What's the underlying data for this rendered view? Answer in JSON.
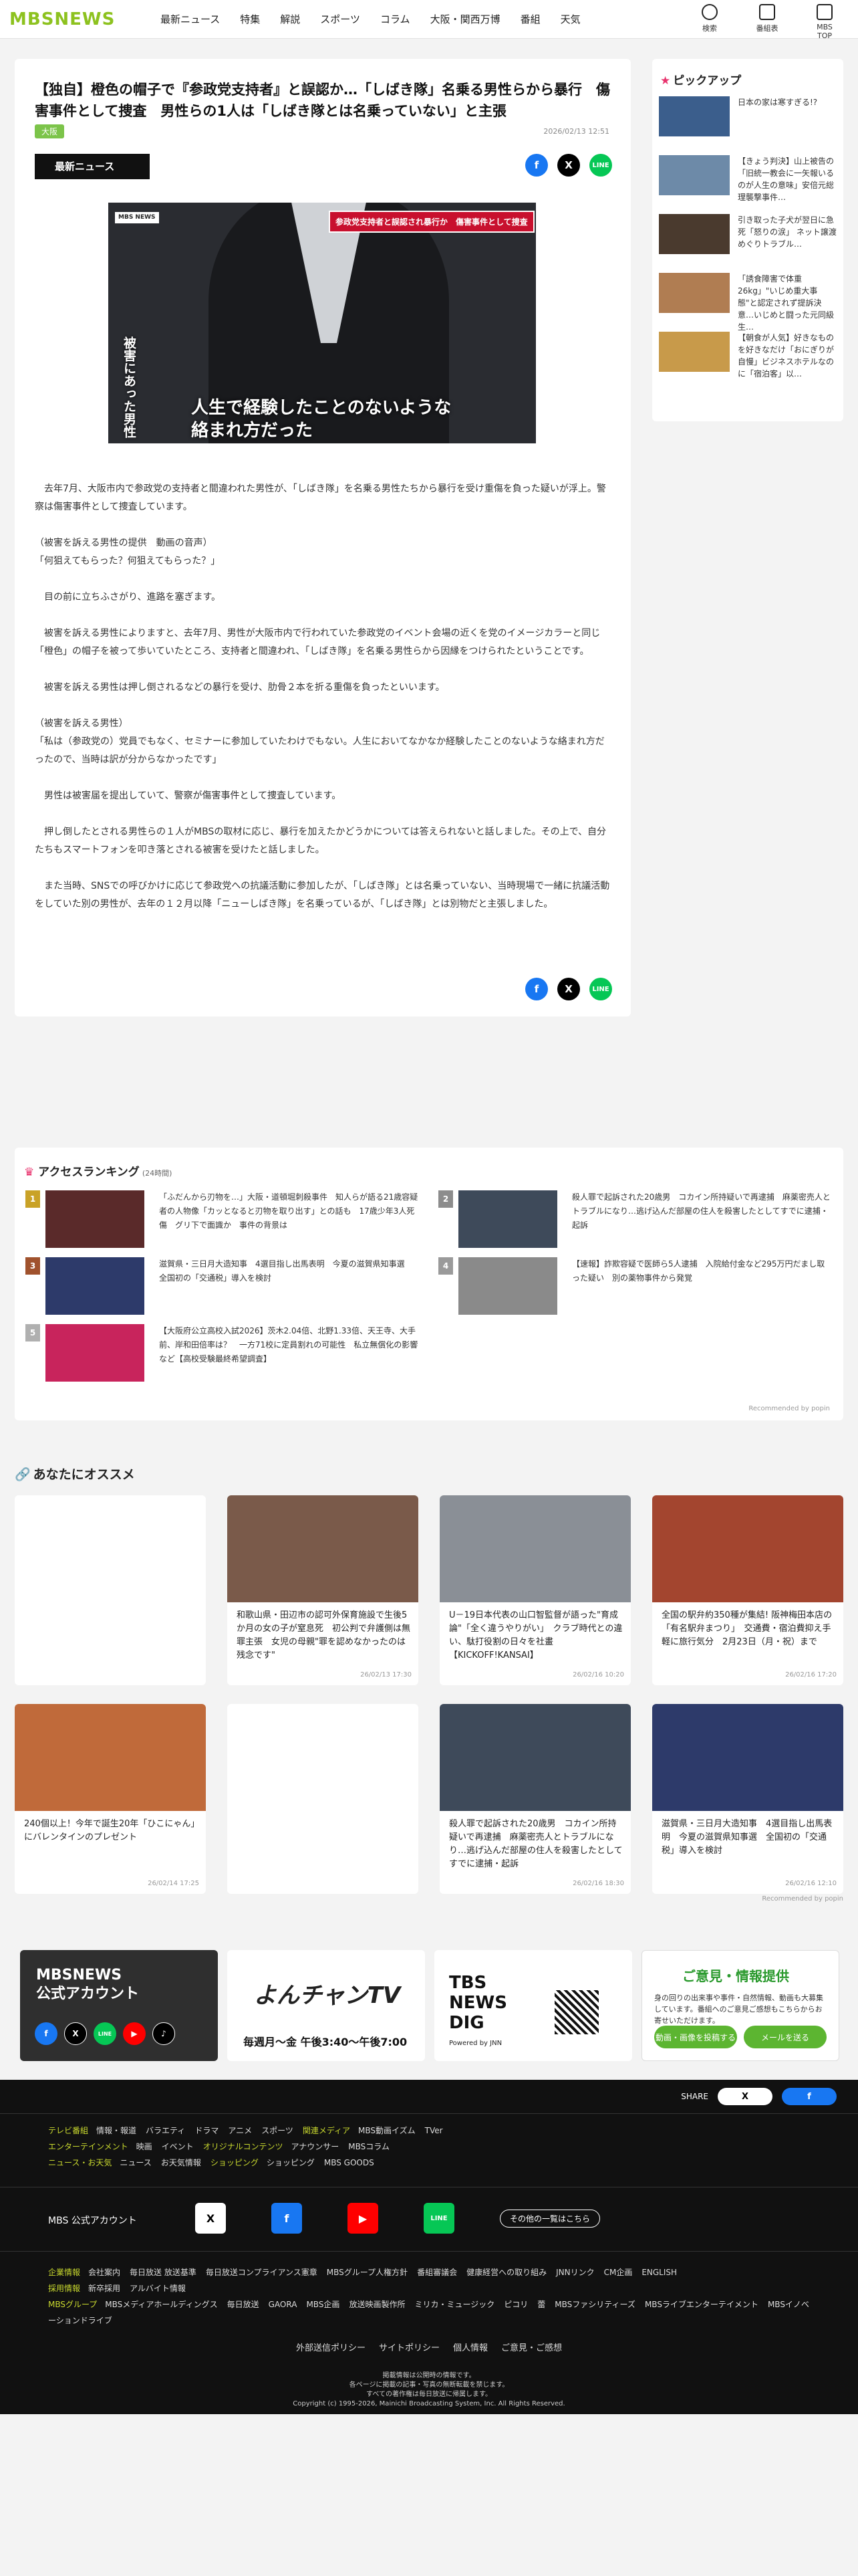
{
  "header": {
    "logo": "MBSNEWS",
    "nav": [
      "最新ニュース",
      "特集",
      "解説",
      "スポーツ",
      "コラム",
      "大阪・関西万博",
      "番組",
      "天気"
    ],
    "icons": [
      {
        "name": "search-icon",
        "label": "検索"
      },
      {
        "name": "calendar-icon",
        "label": "番組表"
      },
      {
        "name": "tv-icon",
        "label": "MBS TOP"
      }
    ]
  },
  "article": {
    "title": "【独自】橙色の帽子で『参政党支持者』と誤認か…「しばき隊」名乗る男性らから暴行　傷害事件として捜査　男性らの1人は「しばき隊とは名乗っていない」と主張",
    "tag": "大阪",
    "date": "2026/02/13 12:51",
    "badge": "最新ニュース",
    "hero": {
      "channel_logo": "MBS NEWS",
      "top_caption": "参政党支持者と誤認され暴行か　傷害事件として捜査",
      "side_caption": "被害にあった男性",
      "caption": "人生で経験したことのないような\n絡まれ方だった"
    },
    "paragraphs": [
      "　去年7月、大阪市内で参政党の支持者と間違われた男性が、「しばき隊」を名乗る男性たちから暴行を受け重傷を負った疑いが浮上。警察は傷害事件として捜査しています。",
      "（被害を訴える男性の提供　動画の音声）\n「何狙えてもらった？何狙えてもらった？」",
      "　目の前に立ちふさがり、進路を塞ぎます。",
      "　被害を訴える男性によりますと、去年7月、男性が大阪市内で行われていた参政党のイベント会場の近くを党のイメージカラーと同じ「橙色」の帽子を被って歩いていたところ、支持者と間違われ、「しばき隊」を名乗る男性らから因縁をつけられたということです。",
      "　被害を訴える男性は押し倒されるなどの暴行を受け、肋骨２本を折る重傷を負ったといいます。",
      "（被害を訴える男性）\n「私は（参政党の）党員でもなく、セミナーに参加していたわけでもない。人生においてなかなか経験したことのないような絡まれ方だったので、当時は訳が分からなかったです」",
      "　男性は被害届を提出していて、警察が傷害事件として捜査しています。",
      "　押し倒したとされる男性らの１人がMBSの取材に応じ、暴行を加えたかどうかについては答えられないと話しました。その上で、自分たちもスマートフォンを叩き落とされる被害を受けたと話しました。",
      "　また当時、SNSでの呼びかけに応じて参政党への抗議活動に参加したが、「しばき隊」とは名乗っていない、当時現場で一緒に抗議活動をしていた別の男性が、去年の１２月以降「ニューしばき隊」を名乗っているが、「しばき隊」とは別物だと主張しました。"
    ],
    "share": [
      "f",
      "X",
      "LINE"
    ]
  },
  "pickup": {
    "heading": "ピックアップ",
    "items": [
      {
        "text": "日本の家は寒すぎる!?",
        "color": "#3b5e8c"
      },
      {
        "text": "【きょう判決】山上被告の「旧統一教会に一矢報いるのが人生の意味」安倍元総理襲撃事件…",
        "color": "#6d8aa8"
      },
      {
        "text": "引き取った子犬が翌日に急死「怒りの涙」 ネット譲渡めぐりトラブル…",
        "color": "#4a3a2e"
      },
      {
        "text": "「誘食障害で体重26kg」\"いじめ重大事態\"と認定されず提訴決意…いじめと闘った元同級生…",
        "color": "#b07d52"
      },
      {
        "text": "【朝食が人気】好きなものを好きなだけ「おにぎりが自慢」ビジネスホテルなのに「宿泊客」以…",
        "color": "#c89a4a"
      }
    ]
  },
  "ranking": {
    "heading": "アクセスランキング",
    "sub": "(24時間)",
    "items": [
      {
        "rank": "1",
        "rank_color": "#c9a227",
        "thumb_color": "#5a2a2a",
        "text": "「ふだんから刃物を…」大阪・道頓堀刺殺事件　知人らが語る21歳容疑者の人物像「カッとなると刃物を取り出す」との話も　17歳少年3人死傷　グリ下で面識か　事件の背景は"
      },
      {
        "rank": "2",
        "rank_color": "#8c8c8c",
        "thumb_color": "#3e4a5a",
        "text": "殺人罪で起訴された20歳男　コカイン所持疑いで再逮捕　麻薬密売人とトラブルになり…逃げ込んだ部屋の住人を殺害したとしてすでに逮捕・起訴"
      },
      {
        "rank": "3",
        "rank_color": "#a0522d",
        "thumb_color": "#2d3a6a",
        "text": "滋賀県・三日月大造知事　4選目指し出馬表明　今夏の滋賀県知事選　全国初の「交通税」導入を検討"
      },
      {
        "rank": "4",
        "rank_color": "#9a9a9a",
        "thumb_color": "#8a8a8a",
        "text": "【速報】詐欺容疑で医師ら5人逮捕　入院給付金など295万円だまし取った疑い　別の薬物事件から発覚"
      },
      {
        "rank": "5",
        "rank_color": "#b0b0b0",
        "thumb_color": "#c8245c",
        "text": "【大阪府公立高校入試2026】茨木2.04倍、北野1.33倍、天王寺、大手前、岸和田倍率は？　一方71校に定員割れの可能性　私立無償化の影響など【高校受験最終希望調査】"
      }
    ],
    "powered": "Recommended by popin"
  },
  "recommend": {
    "heading": "あなたにオススメ",
    "cards": [
      {
        "text": "",
        "date": "",
        "thumb_color": "#ffffff"
      },
      {
        "text": "和歌山県・田辺市の認可外保育施設で生後5か月の女の子が窒息死　初公判で弁護側は無罪主張　女児の母親\"罪を認めなかったのは残念です\"",
        "date": "26/02/13 17:30",
        "thumb_color": "#7a5a4a"
      },
      {
        "text": "U－19日本代表の山口智監督が語った\"育成論\"「全く違うやりがい」　クラブ時代との違い、駄打役割の日々を社畫【KICKOFF!KANSAI】",
        "date": "26/02/16 10:20",
        "thumb_color": "#8a8f96"
      },
      {
        "text": "全国の駅弁約350種が集結! 阪神梅田本店の「有名駅弁まつり」　交通費・宿泊費抑え手軽に旅行気分　2月23日（月・祝）まで",
        "date": "26/02/16 17:20",
        "thumb_color": "#a3452f"
      },
      {
        "text": "240個以上！今年で誕生20年「ひこにゃん」にバレンタインのプレゼント",
        "date": "26/02/14 17:25",
        "thumb_color": "#c06a3a"
      },
      {
        "text": "",
        "date": "",
        "thumb_color": "#ffffff"
      },
      {
        "text": "殺人罪で起訴された20歳男　コカイン所持疑いで再逮捕　麻薬密売人とトラブルになり…逃げ込んだ部屋の住人を殺害したとしてすでに逮捕・起訴",
        "date": "26/02/16 18:30",
        "thumb_color": "#3e4a5a"
      },
      {
        "text": "滋賀県・三日月大造知事　4選目指し出馬表明　今夏の滋賀県知事選　全国初の「交通税」導入を検討",
        "date": "26/02/16 12:10",
        "thumb_color": "#2d3a6a"
      }
    ],
    "powered": "Recommended by popin"
  },
  "banners": {
    "official_title": "MBSNEWS\n公式アカウント",
    "official_icons": [
      "f",
      "X",
      "LINE",
      "▶",
      "♪"
    ],
    "yon_title": "よんチャンTV",
    "yon_time": "毎週月～金 午後3:40～午後7:00",
    "tbs_title": "TBS\nNEWS\nDIG",
    "tbs_sub": "Powered by JNN",
    "opinion_title": "ご意見・情報提供",
    "opinion_text": "身の回りの出来事や事件・自然情報、動画も大募集しています。番組へのご意見ご感想もこちらからお寄せいただけます。",
    "opinion_btn1": "動画・画像を投稿する",
    "opinion_btn2": "メールを送る"
  },
  "footer": {
    "share_label": "SHARE",
    "share_x": "X",
    "share_fb": "f",
    "rows": [
      {
        "label": "テレビ番組",
        "items": [
          "情報・報道",
          "バラエティ",
          "ドラマ",
          "アニメ",
          "スポーツ"
        ],
        "label2": "関連メディア",
        "items2": [
          "MBS動画イズム",
          "TVer"
        ]
      },
      {
        "label": "エンターテインメント",
        "items": [
          "映画",
          "イベント"
        ],
        "label2": "オリジナルコンテンツ",
        "items2": [
          "アナウンサー",
          "MBSコラム"
        ]
      },
      {
        "label": "ニュース・お天気",
        "items": [
          "ニュース",
          "お天気情報"
        ],
        "label2": "ショッピング",
        "items2": [
          "ショッピング",
          "MBS GOODS"
        ]
      }
    ],
    "official_label": "MBS 公式アカウント",
    "official_more": "その他の一覧はこちら",
    "rows2": [
      {
        "label": "企業情報",
        "items": [
          "会社案内",
          "毎日放送 放送基準",
          "毎日放送コンプライアンス憲章",
          "MBSグループ人権方針",
          "番組審議会",
          "健康経営への取り組み",
          "JNNリンク",
          "CM企画",
          "ENGLISH"
        ]
      },
      {
        "label": "採用情報",
        "items": [
          "新卒採用",
          "アルバイト情報"
        ]
      },
      {
        "label": "MBSグループ",
        "items": [
          "MBSメディアホールディングス",
          "毎日放送",
          "GAORA",
          "MBS企画",
          "放送映画製作所",
          "ミリカ・ミュージック",
          "ピコリ",
          "蕾",
          "MBSファシリティーズ",
          "MBSライブエンターテイメント",
          "MBSイノベーションドライブ"
        ]
      }
    ],
    "policy": [
      "外部送信ポリシー",
      "サイトポリシー",
      "個人情報",
      "ご意見・ご感想"
    ],
    "copyright": "掲載情報は公開時の情報です。\n各ページに掲載の記事・写真の無断転載を禁じます。\nすべての著作権は毎日放送に帰属します。\nCopyright (c) 1995-2026, Mainichi Broadcasting System, Inc. All Rights Reserved."
  }
}
